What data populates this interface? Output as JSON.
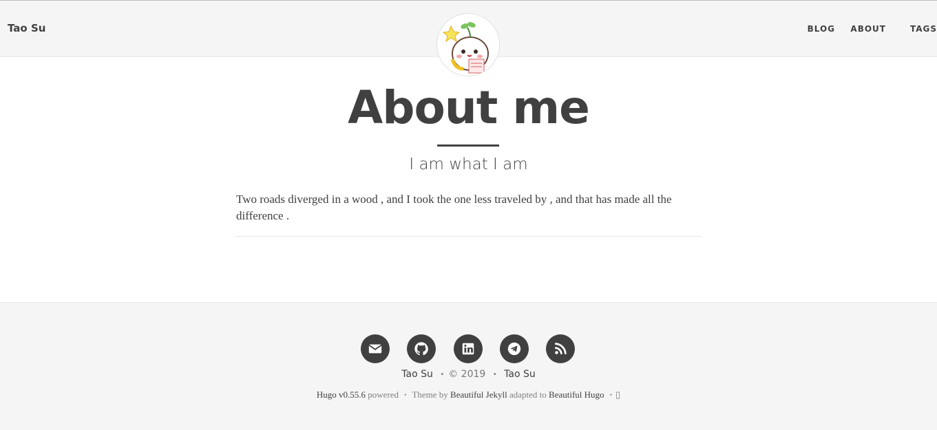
{
  "navbar": {
    "brand": "Tao Su",
    "links": [
      {
        "label": "BLOG"
      },
      {
        "label": "ABOUT"
      },
      {
        "label": "TAGS"
      }
    ]
  },
  "avatar": {
    "icon": "cartoon-sprout-avatar"
  },
  "header": {
    "title": "About me",
    "subtitle": "I am what I am"
  },
  "content": {
    "paragraph": "Two roads diverged in a wood , and I took the one less traveled by , and that has made all the difference ."
  },
  "footer": {
    "social": [
      {
        "icon": "envelope-icon"
      },
      {
        "icon": "github-icon"
      },
      {
        "icon": "linkedin-icon"
      },
      {
        "icon": "telegram-icon"
      },
      {
        "icon": "rss-icon"
      }
    ],
    "author": "Tao Su",
    "copyright": "© 2019",
    "site": "Tao Su",
    "hugo_link": "Hugo v0.55.6",
    "powered": "powered",
    "theme_by": "Theme by",
    "jekyll_link": "Beautiful Jekyll",
    "adapted_to": "adapted to",
    "hugo_theme_link": "Beautiful Hugo",
    "extra_glyph": "▯"
  },
  "colors": {
    "text": "#404040",
    "nav_bg": "#f5f5f5",
    "icon_bg": "#404040"
  }
}
